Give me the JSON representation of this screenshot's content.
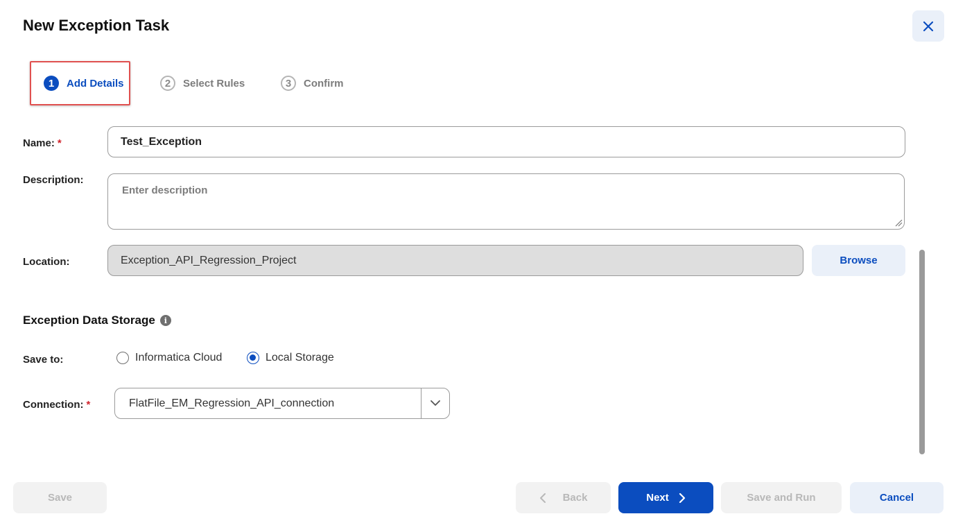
{
  "dialog": {
    "title": "New Exception Task",
    "close_icon": "close-icon"
  },
  "steps": [
    {
      "number": "1",
      "label": "Add Details",
      "state": "active"
    },
    {
      "number": "2",
      "label": "Select Rules",
      "state": "inactive"
    },
    {
      "number": "3",
      "label": "Confirm",
      "state": "inactive"
    }
  ],
  "form": {
    "name_label": "Name:",
    "required_mark": "*",
    "name_value": "Test_Exception",
    "description_label": "Description:",
    "description_placeholder": "Enter description",
    "location_label": "Location:",
    "location_value": "Exception_API_Regression_Project",
    "browse_label": "Browse"
  },
  "storage": {
    "section_title": "Exception Data Storage",
    "info_icon": "info-icon",
    "save_to_label": "Save to:",
    "options": [
      {
        "label": "Informatica Cloud",
        "checked": false
      },
      {
        "label": "Local Storage",
        "checked": true
      }
    ],
    "connection_label": "Connection:",
    "connection_value": "FlatFile_EM_Regression_API_connection"
  },
  "footer": {
    "save_label": "Save",
    "back_label": "Back",
    "next_label": "Next",
    "save_and_run_label": "Save and Run",
    "cancel_label": "Cancel"
  },
  "colors": {
    "accent": "#0b4dbf",
    "highlight": "#e0504f",
    "required": "#d0242c"
  }
}
